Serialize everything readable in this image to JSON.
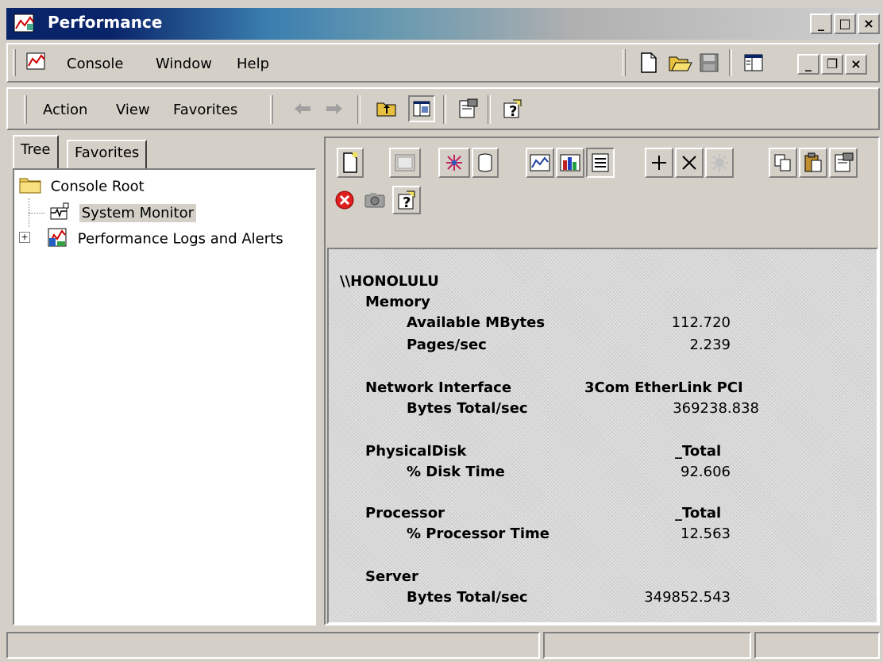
{
  "window": {
    "title": "Performance",
    "caption_buttons": {
      "minimize": "_",
      "maximize": "□",
      "close": "×"
    }
  },
  "menubar": {
    "items": [
      {
        "label": "Console",
        "accel": "C"
      },
      {
        "label": "Window",
        "accel": "W"
      },
      {
        "label": "Help",
        "accel": "H"
      }
    ],
    "child_buttons": {
      "minimize": "_",
      "restore": "❐",
      "close": "×"
    }
  },
  "actionbar": {
    "items": [
      {
        "label": "Action",
        "accel": "A"
      },
      {
        "label": "View",
        "accel": "V"
      },
      {
        "label": "Favorites",
        "accel": "F"
      }
    ]
  },
  "tree_tabs": {
    "tree": "Tree",
    "favorites": "Favorites"
  },
  "tree": {
    "root": "Console Root",
    "items": [
      {
        "label": "System Monitor",
        "selected": true
      },
      {
        "label": "Performance Logs and Alerts",
        "expander": "+"
      }
    ]
  },
  "report": {
    "computer": "\\\\HONOLULU",
    "objects": [
      {
        "name": "Memory",
        "instance": "",
        "counters": [
          {
            "name": "Available MBytes",
            "value": "112.720"
          },
          {
            "name": "Pages/sec",
            "value": "2.239"
          }
        ]
      },
      {
        "name": "Network Interface",
        "instance": "3Com EtherLink PCI",
        "counters": [
          {
            "name": "Bytes Total/sec",
            "value": "369238.838"
          }
        ]
      },
      {
        "name": "PhysicalDisk",
        "instance": "_Total",
        "counters": [
          {
            "name": "% Disk Time",
            "value": "92.606"
          }
        ]
      },
      {
        "name": "Processor",
        "instance": "_Total",
        "counters": [
          {
            "name": "% Processor Time",
            "value": "12.563"
          }
        ]
      },
      {
        "name": "Server",
        "instance": "",
        "counters": [
          {
            "name": "Bytes Total/sec",
            "value": "349852.543"
          }
        ]
      }
    ]
  },
  "colors": {
    "titlebar_active": "#0a246a",
    "face": "#d4d0c8",
    "selection": "#d4d0c8",
    "delete_red": "#e02020"
  }
}
